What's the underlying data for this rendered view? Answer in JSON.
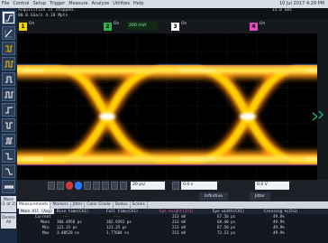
{
  "menubar": {
    "items": [
      "File",
      "Control",
      "Setup",
      "Trigger",
      "Measure",
      "Analyze",
      "Utilities",
      "Help"
    ],
    "datetime": "10 Jul 2017  4:29 PM"
  },
  "status": {
    "acquisition": "Acquisition is stopped.",
    "rate": "80.0 GSa/s   4.10 Mpts",
    "right1": "15.0 GHz",
    "right2": "15.0 GHz"
  },
  "channels": [
    {
      "num": "1",
      "state": "On",
      "color": "#f2d200"
    },
    {
      "num": "2",
      "state": "On",
      "color": "#2fb24c",
      "field": "200 mV/"
    },
    {
      "num": "3",
      "state": "On",
      "color": "#ffffff"
    },
    {
      "num": "4",
      "state": "On",
      "color": "#e54bc0"
    }
  ],
  "left_toolbar": {
    "more_label": "More",
    "more_sub": "(1 of 2)",
    "delete_label": "Delete",
    "delete_sub": "All",
    "icons": [
      "rise-time-icon",
      "pulse-icon",
      "pulse-width-icon",
      "eye-icon",
      "square-wave-icon",
      "step-icon",
      "edge-icon",
      "period-icon",
      "frequency-icon",
      "step-down-icon",
      "fall-icon",
      "burst-icon"
    ]
  },
  "controls": {
    "timebase": "20 ps/",
    "delay": "0.0 s",
    "trigger_left": "Infinitive",
    "trigger_right": "Jitter",
    "trig_level": "0.0 V"
  },
  "tabs": [
    "Measurements",
    "Markers",
    "Jitter",
    "Color Grade",
    "Status",
    "Scales"
  ],
  "meas": {
    "mean_all_label": "Mean All  (Avg)",
    "headers": [
      "Rise time(Ch1)",
      "Fall time(Ch1)",
      "Eye height(Ch1)",
      "Eye width(Ch1)",
      "Crossing %(Ch1)"
    ],
    "rows": [
      {
        "label": "Current",
        "vals": [
          "---",
          "---",
          "213 mV",
          "67.50 ps",
          "49.8%"
        ]
      },
      {
        "label": "Mean",
        "vals": [
          "304.4958 ps",
          "282.9393 ps",
          "213 mV",
          "68.40 ps",
          "49.9%"
        ]
      },
      {
        "label": "Min",
        "vals": [
          "121.25 ps",
          "121.25 ps",
          "213 mV",
          "67.50 ps",
          "49.9%"
        ]
      },
      {
        "label": "Max",
        "vals": [
          "3.00528 ns",
          "1.77684 ns",
          "213 mV",
          "72.23 ps",
          "49.9%"
        ]
      }
    ]
  },
  "colors": {
    "eye_hot": "#ffffff",
    "eye_core": "#ffd400",
    "eye_warm": "#ff8a00",
    "eye_edge_cyan": "#1fb7ff",
    "eye_edge_green": "#1fd06a"
  }
}
